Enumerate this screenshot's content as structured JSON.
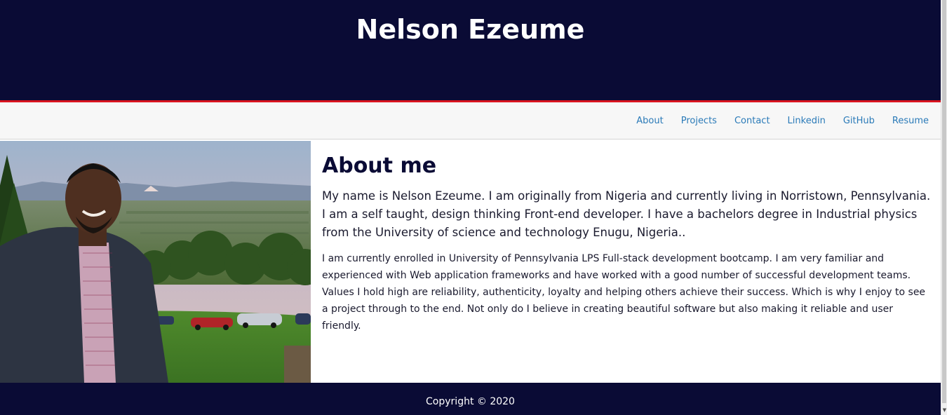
{
  "header": {
    "title": "Nelson Ezeume"
  },
  "nav": {
    "items": [
      {
        "label": "About"
      },
      {
        "label": "Projects"
      },
      {
        "label": "Contact"
      },
      {
        "label": "Linkedin"
      },
      {
        "label": "GitHub"
      },
      {
        "label": "Resume"
      }
    ]
  },
  "about": {
    "title": "About me",
    "lead": "My name is Nelson Ezeume. I am originally from Nigeria and currently living in Norristown, Pennsylvania. I am a self taught, design thinking Front-end developer. I have a bachelors degree in Industrial physics from the University of science and technology Enugu, Nigeria..",
    "body": "I am currently enrolled in University of Pennsylvania LPS Full-stack development bootcamp. I am very familiar and experienced with Web application frameworks and have worked with a good number of successful development teams. Values I hold high are reliability, authenticity, loyalty and helping others achieve their success. Which is why I enjoy to see a project through to the end. Not only do I believe in creating beautiful software but also making it reliable and user friendly."
  },
  "footer": {
    "copyright": "Copyright © 2020"
  },
  "colors": {
    "header_bg": "#0a0b35",
    "accent": "#d9141f",
    "nav_link": "#2a7ab8",
    "navbar_bg": "#f7f7f7"
  },
  "icons": {
    "scroll_down": "chevron-down-icon"
  }
}
